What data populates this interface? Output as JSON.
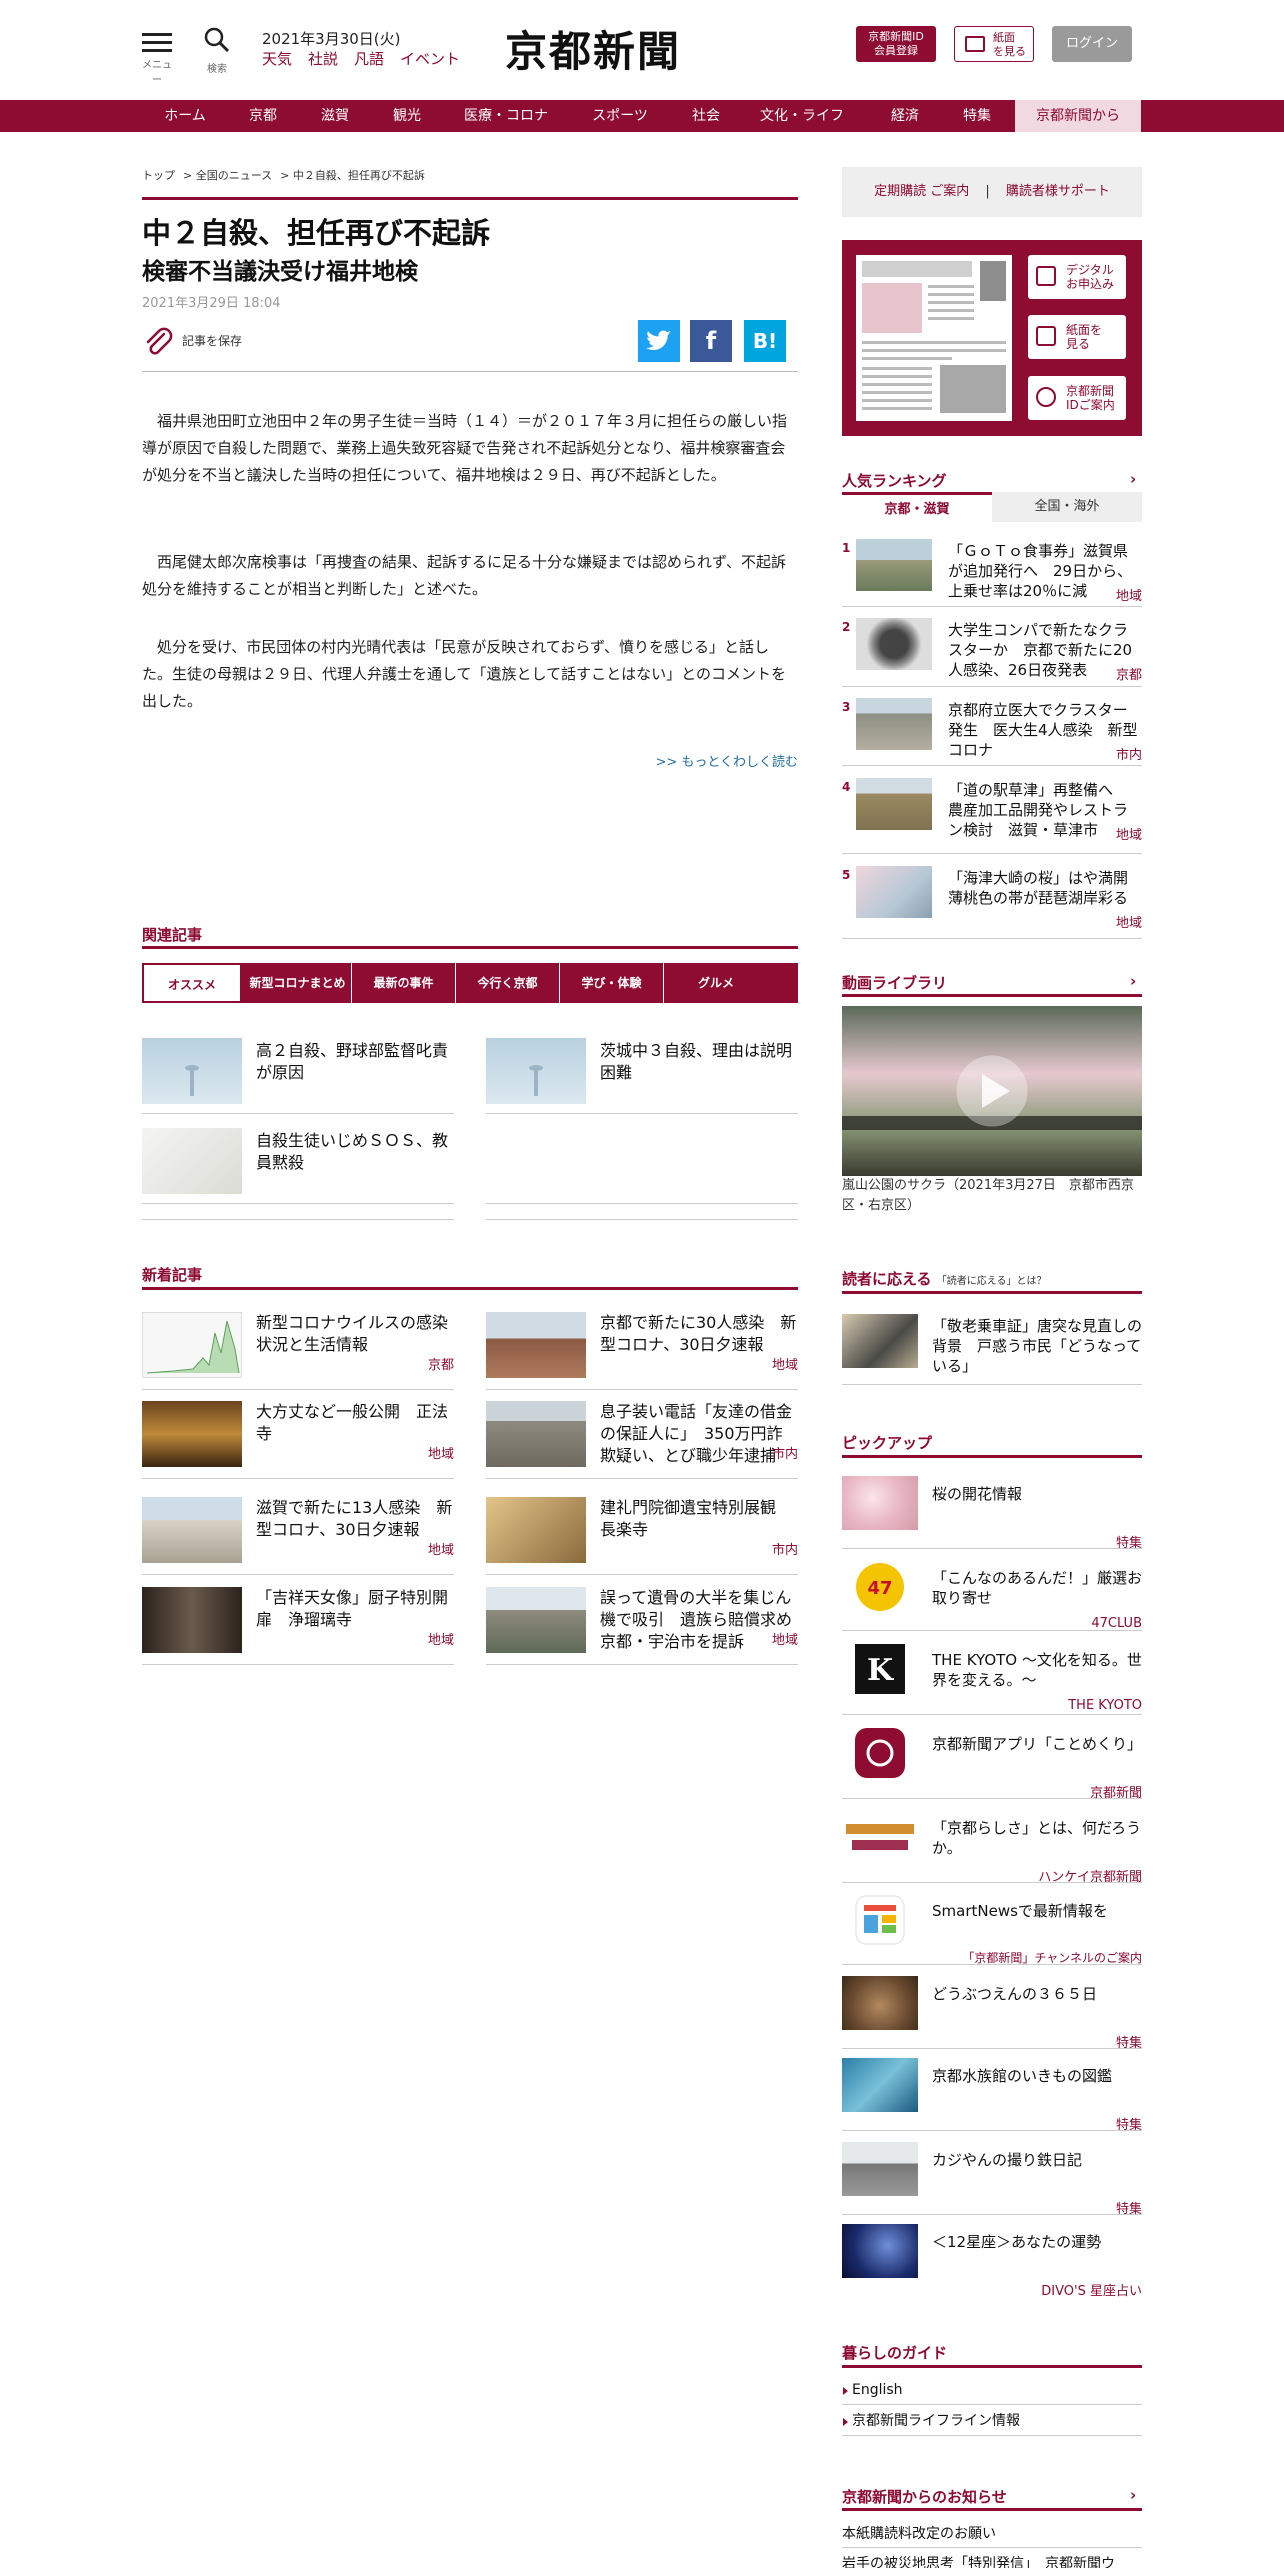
{
  "header": {
    "menu_label": "メニュー",
    "search_label": "検索",
    "date": "2021年3月30日(火)",
    "links": [
      "天気",
      "社説",
      "凡語",
      "イベント"
    ],
    "logo": "京都新聞",
    "id_button": [
      "京都新聞ID",
      "会員登録"
    ],
    "paper_button": [
      "紙面",
      "を見る"
    ],
    "login_button": "ログイン"
  },
  "nav": [
    "ホーム",
    "京都",
    "滋賀",
    "観光",
    "医療・コロナ",
    "スポーツ",
    "社会",
    "文化・ライフ",
    "経済",
    "特集",
    "京都新聞から"
  ],
  "breadcrumb": [
    "トップ",
    "> 全国のニュース",
    "> 中２自殺、担任再び不起訴"
  ],
  "article": {
    "title": "中２自殺、担任再び不起訴",
    "subtitle": "検審不当議決受け福井地検",
    "date": "2021年3月29日 18:04",
    "save_label": "記事を保存",
    "paragraphs": [
      "福井県池田町立池田中２年の男子生徒＝当時（１４）＝が２０１７年３月に担任らの厳しい指導が原因で自殺した問題で、業務上過失致死容疑で告発され不起訴処分となり、福井検察審査会が処分を不当と議決した当時の担任について、福井地検は２９日、再び不起訴とした。",
      "西尾健太郎次席検事は「再捜査の結果、起訴するに足る十分な嫌疑までは認められず、不起訴処分を維持することが相当と判断した」と述べた。",
      "処分を受け、市民団体の村内光晴代表は「民意が反映されておらず、憤りを感じる」と話した。生徒の母親は２９日、代理人弁護士を通して「遺族として話すことはない」とのコメントを出した。"
    ],
    "more": ">> もっとくわしく読む"
  },
  "related": {
    "title": "関連記事",
    "tabs": [
      "オススメ",
      "新型コロナまとめ",
      "最新の事件",
      "今行く京都",
      "学び・体験",
      "グルメ"
    ],
    "items": [
      "高２自殺、野球部監督叱責が原因",
      "茨城中３自殺、理由は説明困難",
      "自殺生徒いじめＳＯＳ、教員黙殺"
    ]
  },
  "latest": {
    "title": "新着記事",
    "items": [
      {
        "text": "新型コロナウイルスの感染状況と生活情報",
        "tag": "京都"
      },
      {
        "text": "京都で新たに30人感染　新型コロナ、30日夕速報",
        "tag": "地域"
      },
      {
        "text": "大方丈など一般公開　正法寺",
        "tag": "地域"
      },
      {
        "text": "息子装い電話「友達の借金の保証人に」　350万円詐欺疑い、とび職少年逮捕",
        "tag": "市内"
      },
      {
        "text": "滋賀で新たに13人感染　新型コロナ、30日夕速報",
        "tag": "地域"
      },
      {
        "text": "建礼門院御遺宝特別展観　長楽寺",
        "tag": "市内"
      },
      {
        "text": "「吉祥天女像」厨子特別開扉　浄瑠璃寺",
        "tag": "地域"
      },
      {
        "text": "誤って遺骨の大半を集じん機で吸引　遺族ら賠償求め京都・宇治市を提訴",
        "tag": "地域"
      }
    ]
  },
  "sidebar": {
    "subscribe": [
      "定期購読 ご案内",
      "|",
      "購読者様サポート"
    ],
    "paper_buttons": [
      [
        "デジタル",
        "お申込み"
      ],
      [
        "紙面を",
        "見る"
      ],
      [
        "京都新聞",
        "IDご案内"
      ]
    ],
    "ranking": {
      "title": "人気ランキング",
      "tabs": [
        "京都・滋賀",
        "全国・海外"
      ],
      "items": [
        {
          "no": "1",
          "text": "「ＧｏＴｏ食事券」滋賀県が追加発行へ　29日から、上乗せ率は20％に減",
          "tag": "地域"
        },
        {
          "no": "2",
          "text": "大学生コンパで新たなクラスターか　京都で新たに20人感染、26日夜発表",
          "tag": "京都"
        },
        {
          "no": "3",
          "text": "京都府立医大でクラスター発生　医大生4人感染　新型コロナ",
          "tag": "市内"
        },
        {
          "no": "4",
          "text": "「道の駅草津」再整備へ　農産加工品開発やレストラン検討　滋賀・草津市",
          "tag": "地域"
        },
        {
          "no": "5",
          "text": "「海津大崎の桜」はや満開　薄桃色の帯が琵琶湖岸彩る",
          "tag": "地域"
        }
      ]
    },
    "video": {
      "title": "動画ライブラリ",
      "caption": "嵐山公園のサクラ（2021年3月27日　京都市西京区・右京区）"
    },
    "reader": {
      "title": "読者に応える",
      "note": "「読者に応える」とは？",
      "item": "「敬老乗車証」唐突な見直しの背景　戸惑う市民「どうなっている」"
    },
    "pickup": {
      "title": "ピックアップ",
      "items": [
        {
          "text": "桜の開花情報",
          "tag": "特集"
        },
        {
          "text": "「こんなのあるんだ！」厳選お取り寄せ",
          "tag": "47CLUB"
        },
        {
          "text": "THE KYOTO ～文化を知る。世界を変える。～",
          "tag": "THE KYOTO"
        },
        {
          "text": "京都新聞アプリ「ことめくり」",
          "tag": "京都新聞"
        },
        {
          "text": "「京都らしさ」とは、何だろうか。",
          "tag": "ハンケイ京都新聞"
        },
        {
          "text": "SmartNewsで最新情報を",
          "tag": "「京都新聞」チャンネルのご案内"
        },
        {
          "text": "どうぶつえんの３６５日",
          "tag": "特集"
        },
        {
          "text": "京都水族館のいきもの図鑑",
          "tag": "特集"
        },
        {
          "text": "カジやんの撮り鉄日記",
          "tag": "特集"
        },
        {
          "text": "＜12星座＞あなたの運勢",
          "tag": "DIVO'S 星座占い"
        }
      ]
    },
    "guide": {
      "title": "暮らしのガイド",
      "items": [
        "English",
        "京都新聞ライフライン情報"
      ]
    },
    "notice": {
      "title": "京都新聞からのお知らせ",
      "items": [
        "本紙購読料改定のお願い",
        "岩手の被災地思考「特別発信」　京都新聞ウ"
      ]
    },
    "brand": {
      "accent": "#8e0b32"
    }
  }
}
